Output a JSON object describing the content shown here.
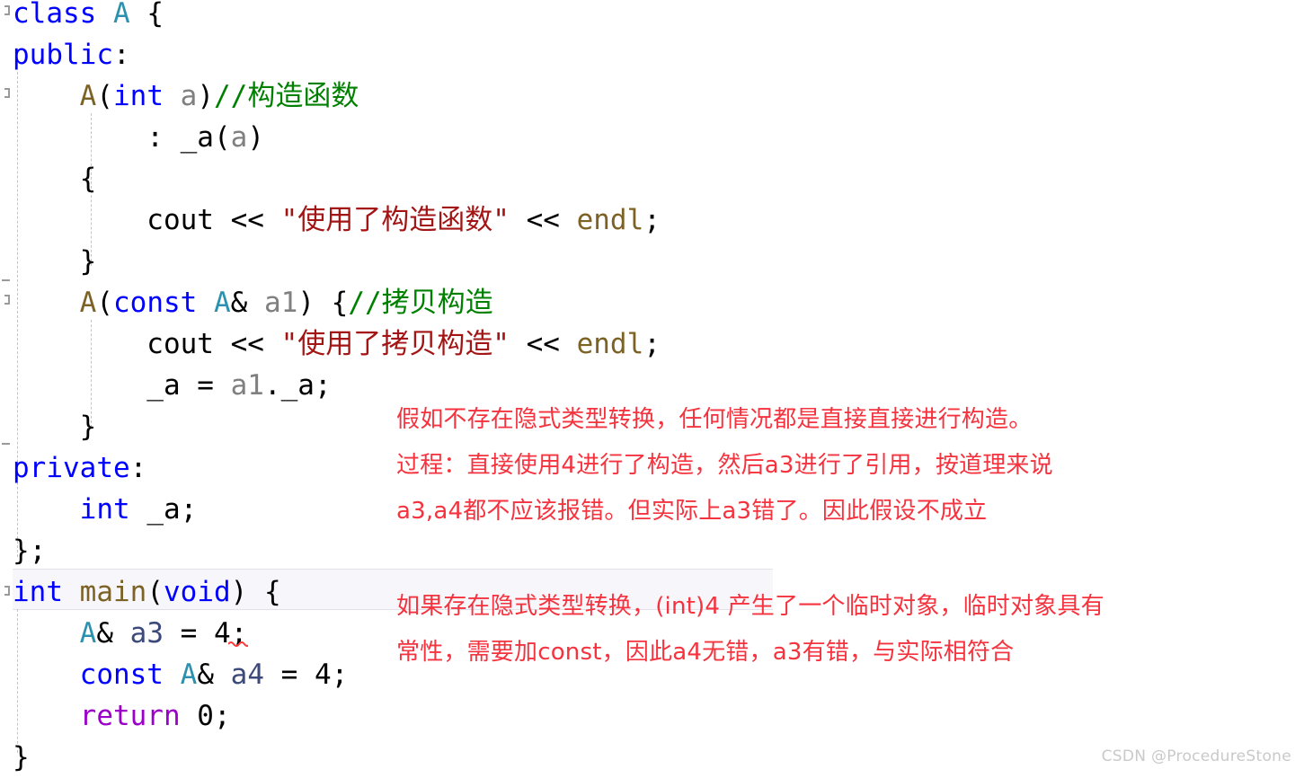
{
  "editor": {
    "language": "cpp",
    "watermark": "CSDN @ProcedureStone",
    "colors": {
      "background": "#ffffff",
      "keyword": "#0000ff",
      "user_type": "#2b91af",
      "function": "#7d6225",
      "parameter": "#808080",
      "comment": "#008000",
      "string": "#a31515",
      "control": "#9b00c9",
      "local_variable": "#3b4a7a",
      "annotation_red": "#f5333f",
      "current_line_highlight": "#f7f7fb",
      "error_squiggle": "#ff3b3b",
      "indent_guide": "#c4c4c4",
      "fold_marker": "#9a9a9a",
      "watermark": "#c9c9c9"
    },
    "lines": [
      {
        "id": "line-class-a",
        "tokens": [
          {
            "text": "class",
            "kind": "keyword"
          },
          {
            "text": " ",
            "kind": "plain"
          },
          {
            "text": "A",
            "kind": "user_type"
          },
          {
            "text": " {",
            "kind": "plain"
          }
        ]
      },
      {
        "id": "line-public",
        "tokens": [
          {
            "text": "public",
            "kind": "keyword"
          },
          {
            "text": ":",
            "kind": "plain"
          }
        ]
      },
      {
        "id": "line-ctor-decl",
        "tokens": [
          {
            "text": "    ",
            "kind": "plain"
          },
          {
            "text": "A",
            "kind": "function"
          },
          {
            "text": "(",
            "kind": "plain"
          },
          {
            "text": "int",
            "kind": "keyword"
          },
          {
            "text": " ",
            "kind": "plain"
          },
          {
            "text": "a",
            "kind": "parameter"
          },
          {
            "text": ")",
            "kind": "plain"
          },
          {
            "text": "//构造函数",
            "kind": "comment"
          }
        ]
      },
      {
        "id": "line-init-list",
        "tokens": [
          {
            "text": "        : _a(",
            "kind": "plain"
          },
          {
            "text": "a",
            "kind": "parameter"
          },
          {
            "text": ")",
            "kind": "plain"
          }
        ]
      },
      {
        "id": "line-ctor-open-brace",
        "tokens": [
          {
            "text": "    {",
            "kind": "plain"
          }
        ]
      },
      {
        "id": "line-cout-ctor",
        "tokens": [
          {
            "text": "        cout << ",
            "kind": "plain"
          },
          {
            "text": "\"使用了构造函数\"",
            "kind": "string"
          },
          {
            "text": " << ",
            "kind": "plain"
          },
          {
            "text": "endl",
            "kind": "function"
          },
          {
            "text": ";",
            "kind": "plain"
          }
        ]
      },
      {
        "id": "line-ctor-close-brace",
        "tokens": [
          {
            "text": "    }",
            "kind": "plain"
          }
        ]
      },
      {
        "id": "line-copy-ctor-decl",
        "tokens": [
          {
            "text": "    ",
            "kind": "plain"
          },
          {
            "text": "A",
            "kind": "function"
          },
          {
            "text": "(",
            "kind": "plain"
          },
          {
            "text": "const",
            "kind": "keyword"
          },
          {
            "text": " ",
            "kind": "plain"
          },
          {
            "text": "A",
            "kind": "user_type"
          },
          {
            "text": "& ",
            "kind": "plain"
          },
          {
            "text": "a1",
            "kind": "parameter"
          },
          {
            "text": ") {",
            "kind": "plain"
          },
          {
            "text": "//拷贝构造",
            "kind": "comment"
          }
        ]
      },
      {
        "id": "line-cout-copy",
        "tokens": [
          {
            "text": "        cout << ",
            "kind": "plain"
          },
          {
            "text": "\"使用了拷贝构造\"",
            "kind": "string"
          },
          {
            "text": " << ",
            "kind": "plain"
          },
          {
            "text": "endl",
            "kind": "function"
          },
          {
            "text": ";",
            "kind": "plain"
          }
        ]
      },
      {
        "id": "line-assign-a",
        "tokens": [
          {
            "text": "        _a = ",
            "kind": "plain"
          },
          {
            "text": "a1",
            "kind": "parameter"
          },
          {
            "text": "._a;",
            "kind": "plain"
          }
        ]
      },
      {
        "id": "line-copy-ctor-close-brace",
        "tokens": [
          {
            "text": "    }",
            "kind": "plain"
          }
        ]
      },
      {
        "id": "line-private",
        "tokens": [
          {
            "text": "private",
            "kind": "keyword"
          },
          {
            "text": ":",
            "kind": "plain"
          }
        ]
      },
      {
        "id": "line-member-a",
        "tokens": [
          {
            "text": "    ",
            "kind": "plain"
          },
          {
            "text": "int",
            "kind": "keyword"
          },
          {
            "text": " _a;",
            "kind": "plain"
          }
        ]
      },
      {
        "id": "line-class-close",
        "tokens": [
          {
            "text": "};",
            "kind": "plain"
          }
        ]
      },
      {
        "id": "line-main",
        "tokens": [
          {
            "text": "int",
            "kind": "keyword"
          },
          {
            "text": " ",
            "kind": "plain"
          },
          {
            "text": "main",
            "kind": "function"
          },
          {
            "text": "(",
            "kind": "plain"
          },
          {
            "text": "void",
            "kind": "keyword"
          },
          {
            "text": ") {",
            "kind": "plain"
          }
        ]
      },
      {
        "id": "line-a3",
        "tokens": [
          {
            "text": "    ",
            "kind": "plain"
          },
          {
            "text": "A",
            "kind": "user_type"
          },
          {
            "text": "& ",
            "kind": "plain"
          },
          {
            "text": "a3",
            "kind": "local_variable"
          },
          {
            "text": " = 4;",
            "kind": "plain"
          }
        ]
      },
      {
        "id": "line-a4",
        "tokens": [
          {
            "text": "    ",
            "kind": "plain"
          },
          {
            "text": "const",
            "kind": "keyword"
          },
          {
            "text": " ",
            "kind": "plain"
          },
          {
            "text": "A",
            "kind": "user_type"
          },
          {
            "text": "& ",
            "kind": "plain"
          },
          {
            "text": "a4",
            "kind": "local_variable"
          },
          {
            "text": " = 4;",
            "kind": "plain"
          }
        ]
      },
      {
        "id": "line-return",
        "tokens": [
          {
            "text": "    ",
            "kind": "plain"
          },
          {
            "text": "return",
            "kind": "control"
          },
          {
            "text": " 0;",
            "kind": "plain"
          }
        ]
      },
      {
        "id": "line-main-close",
        "tokens": [
          {
            "text": "}",
            "kind": "plain"
          }
        ]
      }
    ]
  },
  "annotations": {
    "block_upper": {
      "id": "annotation-assumption-block",
      "lines": [
        "假如不存在隐式类型转换，任何情况都是直接直接进行构造。",
        "过程：直接使用4进行了构造，然后a3进行了引用，按道理来说",
        "a3,a4都不应该报错。但实际上a3错了。因此假设不成立"
      ]
    },
    "block_lower": {
      "id": "annotation-conclusion-block",
      "lines": [
        "如果存在隐式类型转换，(int)4 产生了一个临时对象，临时对象具有",
        "常性，需要加const，因此a4无错，a3有错，与实际相符合"
      ]
    }
  }
}
